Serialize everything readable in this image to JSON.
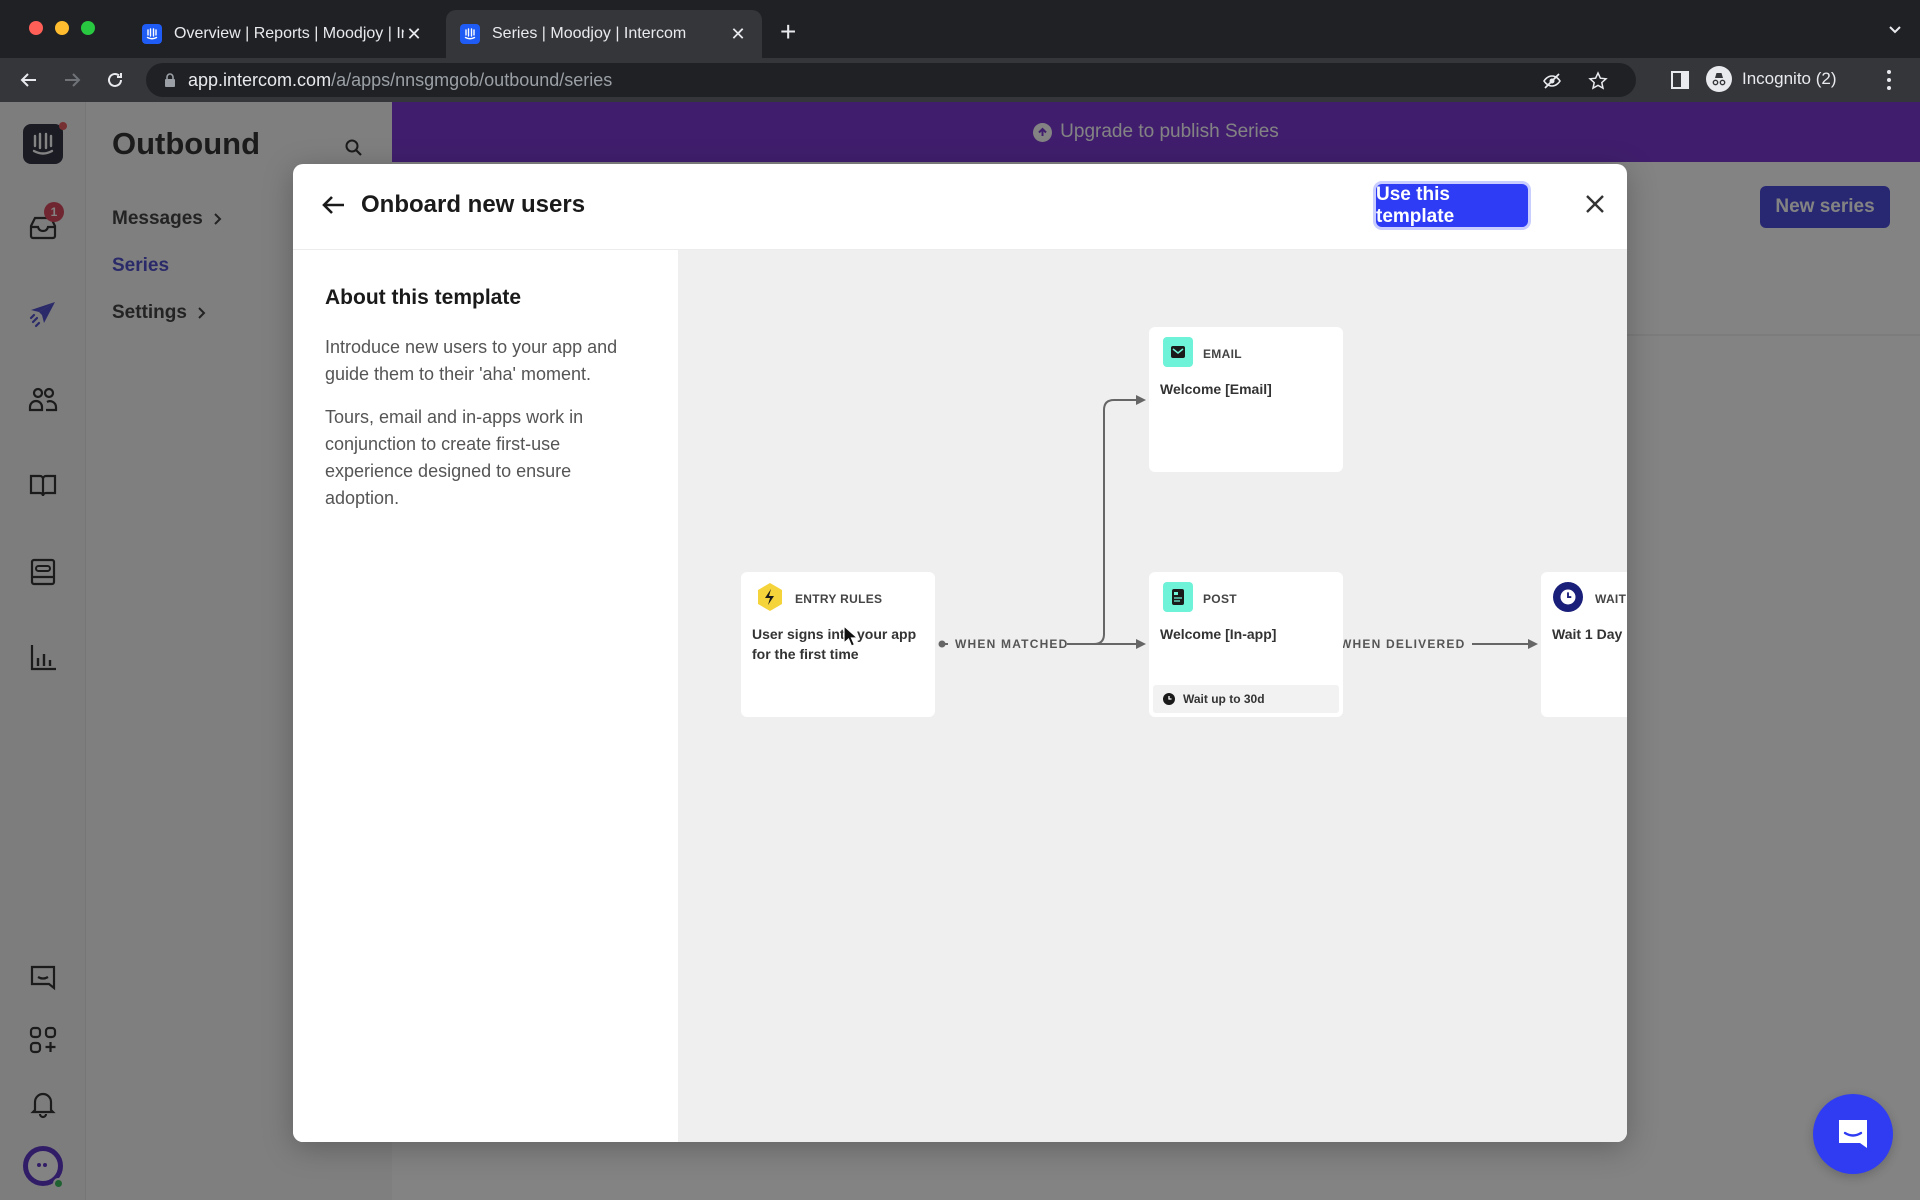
{
  "browser": {
    "tabs": [
      {
        "title": "Overview | Reports | Moodjoy | Intercom",
        "active": false
      },
      {
        "title": "Series | Moodjoy | Intercom",
        "active": true
      }
    ],
    "url_host": "app.intercom.com",
    "url_path": "/a/apps/nnsgmgob/outbound/series",
    "profile_label": "Incognito (2)"
  },
  "rail": {
    "inbox_badge": "1",
    "items": [
      "inbox",
      "outbound",
      "contacts",
      "articles",
      "messenger-settings",
      "reports",
      "conversations",
      "app-store",
      "notifications"
    ]
  },
  "subnav": {
    "title": "Outbound",
    "items": [
      {
        "label": "Messages",
        "has_chevron": true,
        "active": false
      },
      {
        "label": "Series",
        "has_chevron": false,
        "active": true
      },
      {
        "label": "Settings",
        "has_chevron": true,
        "active": false
      }
    ]
  },
  "content": {
    "upgrade_banner": "Upgrade to publish Series",
    "new_series_label": "New series"
  },
  "modal": {
    "title": "Onboard new users",
    "use_template_label": "Use this template",
    "about": {
      "heading": "About this template",
      "paragraphs": [
        "Introduce new users to your app and guide them to their 'aha' moment.",
        "Tours, email and in-apps work in conjunction to create first-use experience designed to ensure adoption."
      ]
    },
    "flow": {
      "nodes": [
        {
          "type": "ENTRY RULES",
          "text": "User signs into your app for the first time",
          "icon": "lightning-icon",
          "color": "#f5d33a"
        },
        {
          "type": "EMAIL",
          "text": "Welcome [Email]",
          "icon": "envelope-icon",
          "color": "#6ef2d8"
        },
        {
          "type": "POST",
          "text": "Welcome [In-app]",
          "icon": "post-icon",
          "color": "#6ef2d8",
          "footer": "Wait up to 30d"
        },
        {
          "type": "WAIT",
          "text": "Wait 1 Day",
          "icon": "clock-icon",
          "color": "#1a1f7a"
        }
      ],
      "edges": [
        {
          "label": "WHEN MATCHED"
        },
        {
          "label": "WHEN DELIVERED"
        }
      ]
    }
  },
  "colors": {
    "accent": "#2e3cf5",
    "banner": "#6b1fcf",
    "active_nav": "#3a39c5"
  }
}
